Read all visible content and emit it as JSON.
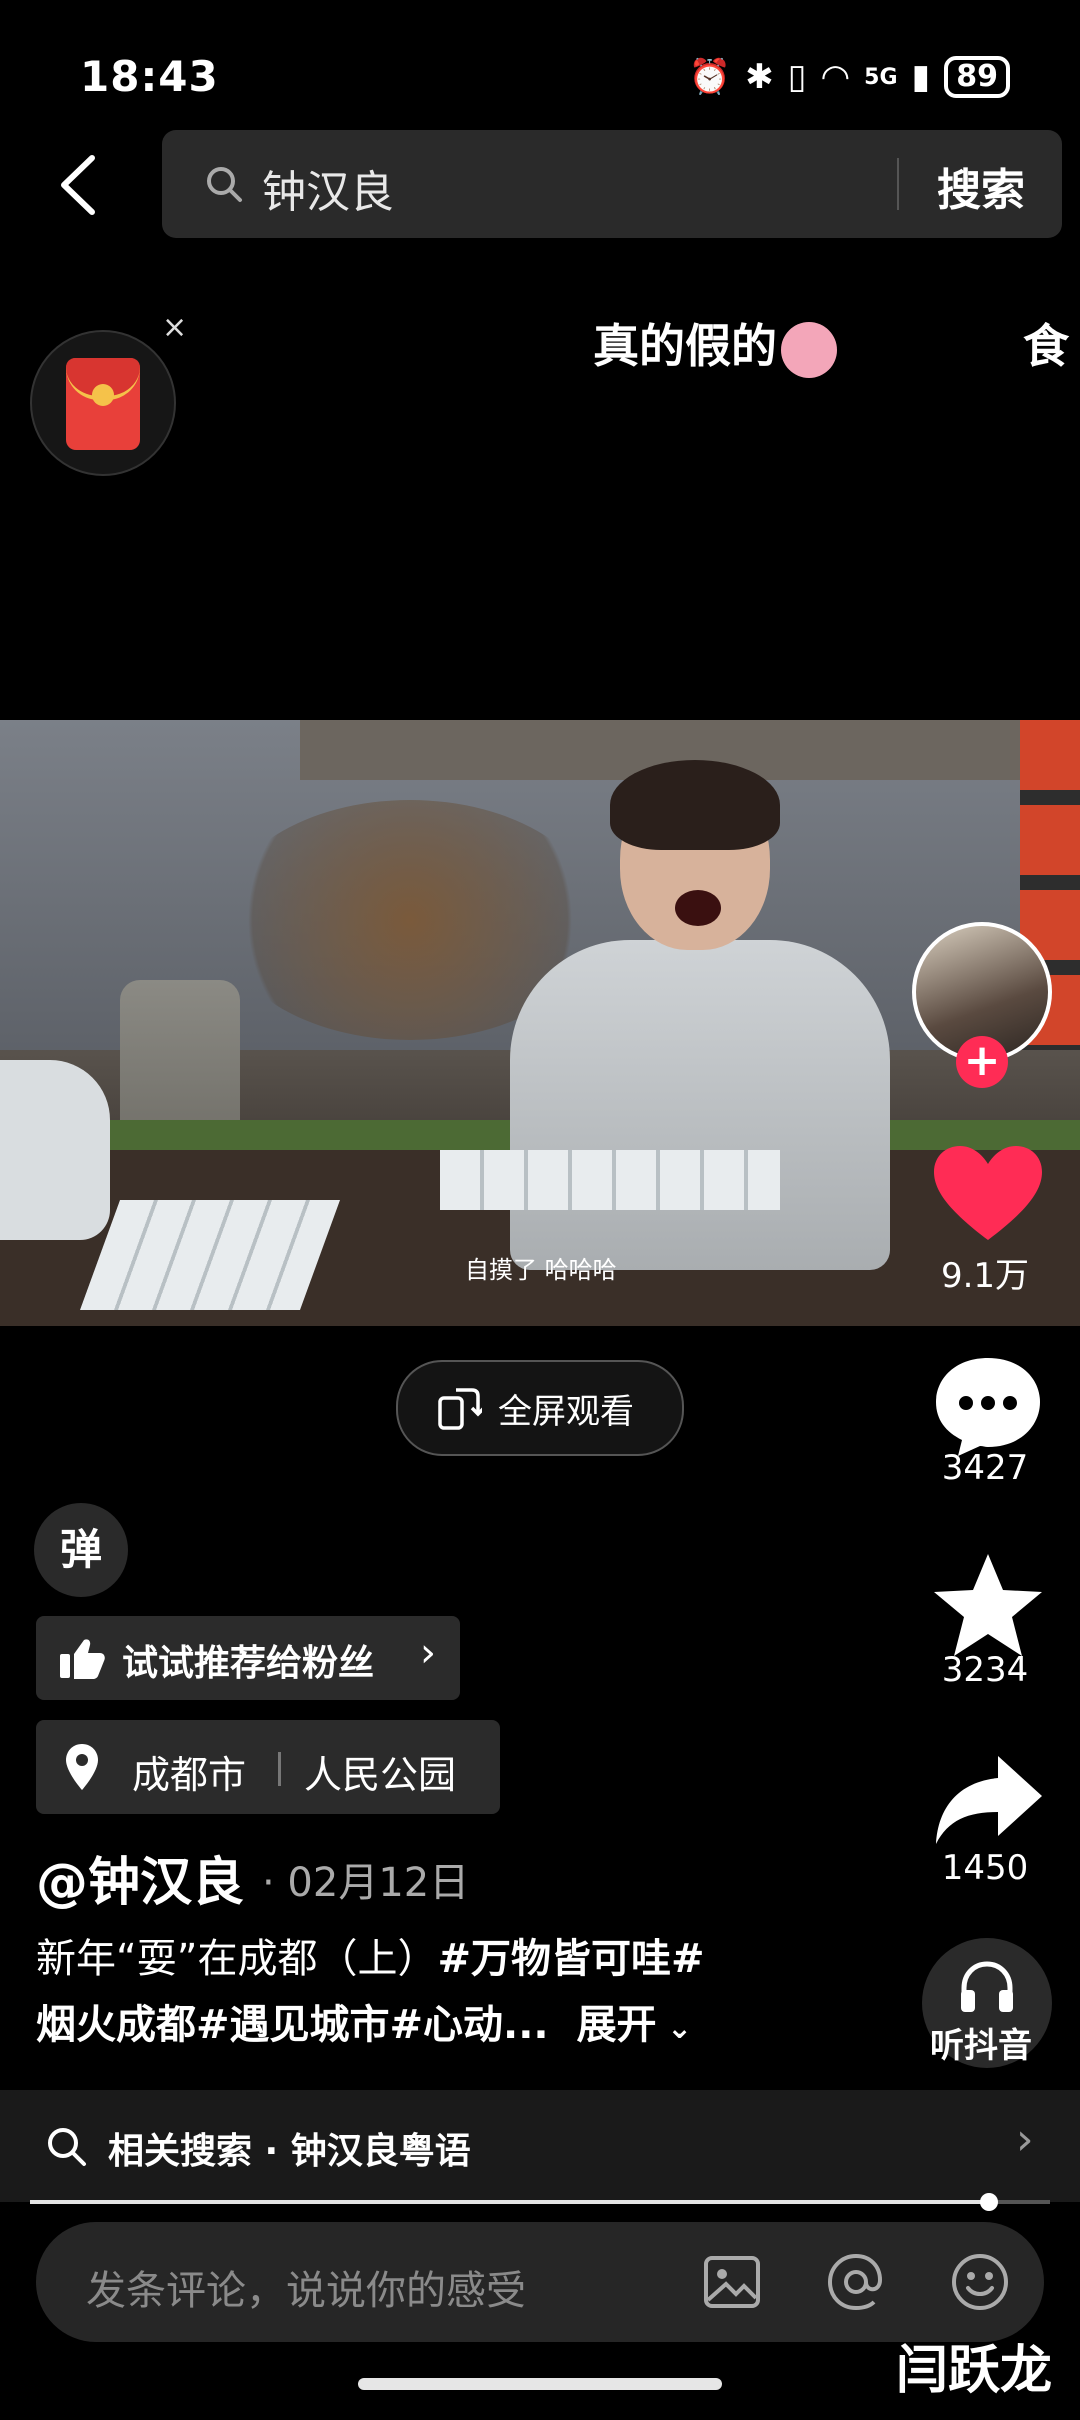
{
  "status_bar": {
    "time": "18:43",
    "network": "5G",
    "battery": "89"
  },
  "search": {
    "query": "钟汉良",
    "button_label": "搜索"
  },
  "trending": [
    "真的假的",
    "食"
  ],
  "video": {
    "subtitle": "自摸了 哈哈哈"
  },
  "actions": {
    "likes": "9.1万",
    "comments": "3427",
    "favorites": "3234",
    "shares": "1450"
  },
  "fullscreen_label": "全屏观看",
  "danmu_label": "弹",
  "recommend_label": "试试推荐给粉丝",
  "location": {
    "city": "成都市",
    "place": "人民公园"
  },
  "post": {
    "author": "@钟汉良",
    "date": "· 02月12日",
    "caption_line1": "新年“耍”在成都（上）",
    "caption_tag1": "#万物皆可哇#",
    "caption_line2": "烟火成都#遇见城市#心动...",
    "expand": "展开"
  },
  "listen_label": "听抖音",
  "related_search": "相关搜索 · 钟汉良粤语",
  "progress": {
    "fraction": 0.94
  },
  "comment_placeholder": "发条评论，说说你的感受",
  "watermark": "闫跃龙",
  "colors": {
    "like": "#ff2c55",
    "background": "#000000",
    "follow": "#ff2c55"
  }
}
